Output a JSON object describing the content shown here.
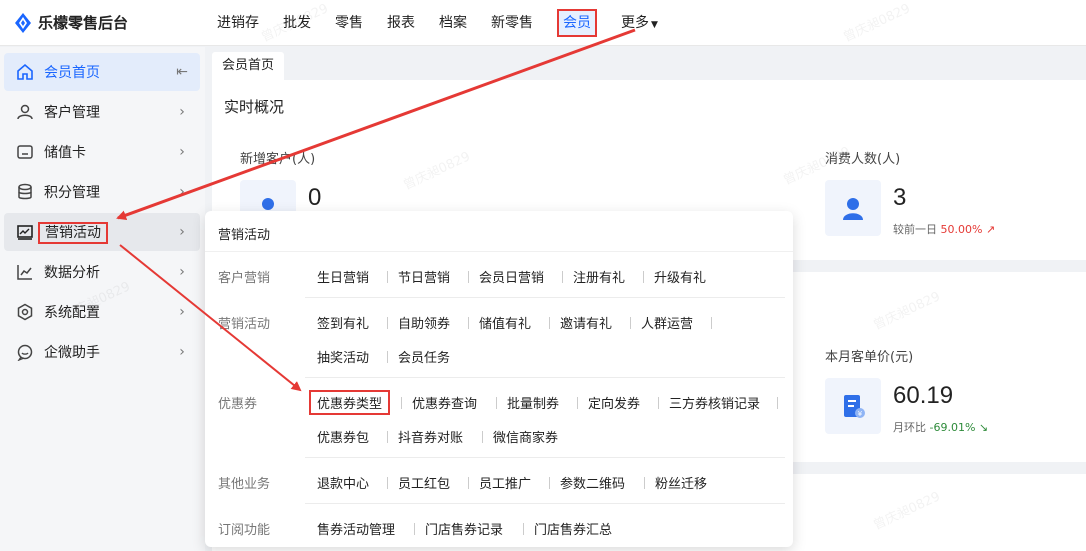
{
  "app": {
    "title": "乐檬零售后台"
  },
  "nav": {
    "items": [
      "进销存",
      "批发",
      "零售",
      "报表",
      "档案",
      "新零售",
      "会员",
      "更多"
    ],
    "active": "会员"
  },
  "sidebar": {
    "items": [
      {
        "label": "会员首页",
        "icon": "home-icon"
      },
      {
        "label": "客户管理",
        "icon": "user-icon"
      },
      {
        "label": "储值卡",
        "icon": "card-icon"
      },
      {
        "label": "积分管理",
        "icon": "database-icon"
      },
      {
        "label": "营销活动",
        "icon": "chart-screen-icon"
      },
      {
        "label": "数据分析",
        "icon": "line-chart-icon"
      },
      {
        "label": "系统配置",
        "icon": "settings-icon"
      },
      {
        "label": "企微助手",
        "icon": "chat-icon"
      }
    ]
  },
  "tabs": {
    "current": "会员首页"
  },
  "overview": {
    "title": "实时概况",
    "new_customers": {
      "label": "新增客户(人)",
      "value": "0"
    },
    "consumers": {
      "label": "消费人数(人)",
      "value": "3",
      "compare_label": "较前一日",
      "compare_value": "50.00%"
    },
    "avg_price": {
      "label": "本月客单价(元)",
      "value": "60.19",
      "compare_label": "月环比",
      "compare_value": "-69.01%"
    }
  },
  "dropdown": {
    "title": "营销活动",
    "groups": [
      {
        "category": "客户营销",
        "links": [
          "生日营销",
          "节日营销",
          "会员日营销",
          "注册有礼",
          "升级有礼"
        ]
      },
      {
        "category": "营销活动",
        "links": [
          "签到有礼",
          "自助领券",
          "储值有礼",
          "邀请有礼",
          "人群运营",
          "抽奖活动",
          "会员任务"
        ]
      },
      {
        "category": "优惠券",
        "links": [
          "优惠券类型",
          "优惠券查询",
          "批量制券",
          "定向发券",
          "三方券核销记录",
          "优惠券包",
          "抖音券对账",
          "微信商家券"
        ]
      },
      {
        "category": "其他业务",
        "links": [
          "退款中心",
          "员工红包",
          "员工推广",
          "参数二维码",
          "粉丝迁移"
        ]
      },
      {
        "category": "订阅功能",
        "links": [
          "售券活动管理",
          "门店售券记录",
          "门店售券汇总"
        ]
      }
    ]
  },
  "watermark": "曾庆昶0829",
  "colors": {
    "accent": "#1a66ff",
    "highlight": "#e53935",
    "up": "#e53935",
    "down": "#2e8b3a"
  }
}
